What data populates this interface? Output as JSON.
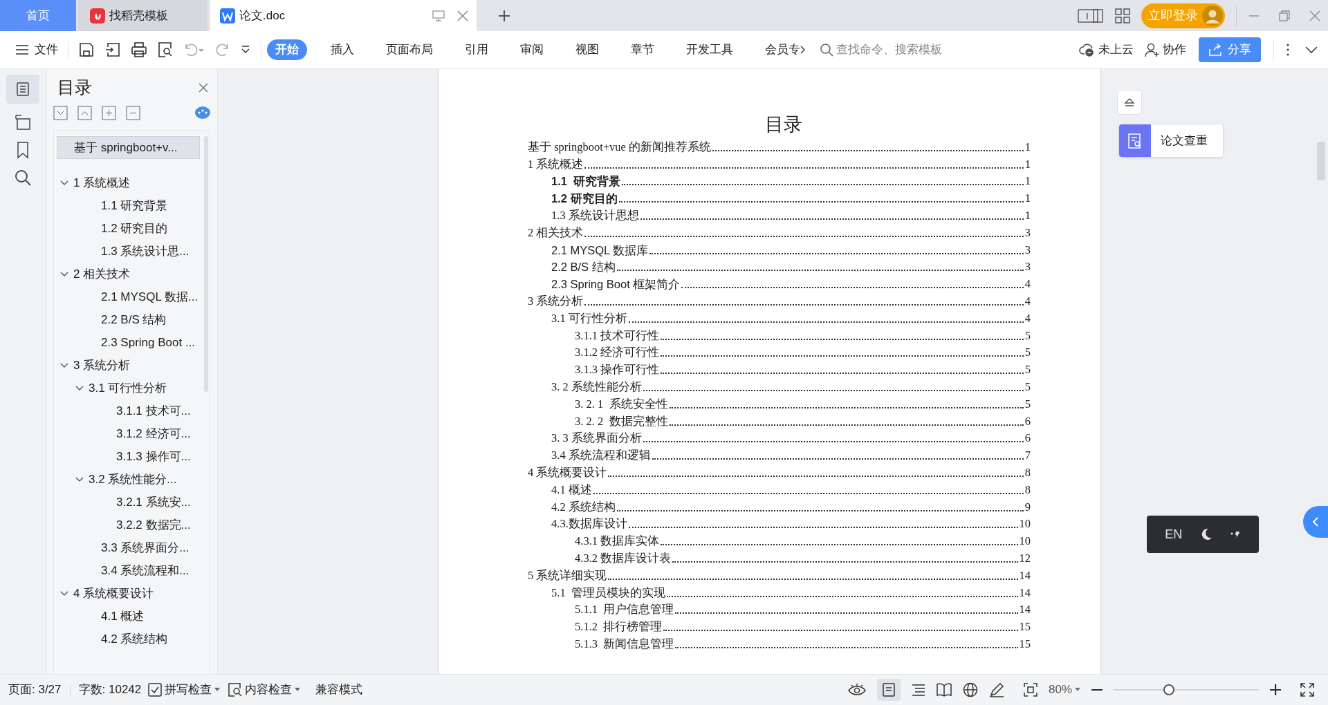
{
  "tabs": [
    {
      "label": "首页",
      "kind": "home",
      "selected": false
    },
    {
      "label": "找稻壳模板",
      "kind": "template",
      "selected": false
    },
    {
      "label": "论文.doc",
      "kind": "document",
      "selected": true
    }
  ],
  "login_button": "立即登录",
  "toolbar": {
    "file_menu": "文件",
    "ribbon_tabs": [
      {
        "label": "开始",
        "selected": true
      },
      {
        "label": "插入",
        "selected": false
      },
      {
        "label": "页面布局",
        "selected": false
      },
      {
        "label": "引用",
        "selected": false
      },
      {
        "label": "审阅",
        "selected": false
      },
      {
        "label": "视图",
        "selected": false
      },
      {
        "label": "章节",
        "selected": false
      },
      {
        "label": "开发工具",
        "selected": false
      },
      {
        "label": "会员专",
        "selected": false
      }
    ],
    "search": {
      "placeholder": "查找命令、搜索模板"
    },
    "cloud_status": "未上云",
    "collaborate": "协作",
    "share": "分享"
  },
  "sidebar": {
    "title": "目录",
    "items": [
      {
        "label": "基于 springboot+v...",
        "selected": true
      },
      {
        "label": "1 系统概述",
        "selected": false,
        "expanded": true,
        "children": [
          {
            "label": "1.1 研究背景",
            "selected": false
          },
          {
            "label": "1.2 研究目的",
            "selected": false
          },
          {
            "label": "1.3 系统设计思...",
            "selected": false
          }
        ]
      },
      {
        "label": "2 相关技术",
        "selected": false,
        "expanded": true,
        "children": [
          {
            "label": "2.1 MYSQL 数据...",
            "selected": false
          },
          {
            "label": "2.2 B/S 结构",
            "selected": false
          },
          {
            "label": "2.3 Spring Boot ...",
            "selected": false
          }
        ]
      },
      {
        "label": "3 系统分析",
        "selected": false,
        "expanded": true,
        "children": [
          {
            "label": "3.1 可行性分析",
            "selected": false,
            "expanded": true,
            "children": [
              {
                "label": "3.1.1 技术可...",
                "selected": false
              },
              {
                "label": "3.1.2 经济可...",
                "selected": false
              },
              {
                "label": "3.1.3 操作可...",
                "selected": false
              }
            ]
          },
          {
            "label": "3.2 系统性能分...",
            "selected": false,
            "expanded": true,
            "children": [
              {
                "label": "3.2.1  系统安...",
                "selected": false
              },
              {
                "label": "3.2.2  数据完...",
                "selected": false
              }
            ]
          },
          {
            "label": "3.3 系统界面分...",
            "selected": false
          },
          {
            "label": "3.4 系统流程和...",
            "selected": false
          }
        ]
      },
      {
        "label": "4 系统概要设计",
        "selected": false,
        "expanded": true,
        "children": [
          {
            "label": "4.1 概述",
            "selected": false
          },
          {
            "label": "4.2 系统结构",
            "selected": false
          }
        ]
      }
    ]
  },
  "document": {
    "title": "目录",
    "entries": [
      {
        "text": "基于 springboot+vue 的新闻推荐系统",
        "page": "1",
        "kind": "serif"
      },
      {
        "text": "1 系统概述",
        "page": "1",
        "kind": "serif",
        "children": [
          {
            "text": "1.1  研究背景",
            "page": "1",
            "kind": "sans-bold"
          },
          {
            "text": "1.2 研究目的",
            "page": "1",
            "kind": "sans-bold"
          },
          {
            "text": "1.3 系统设计思想",
            "page": "1",
            "kind": "serif"
          }
        ]
      },
      {
        "text": "2 相关技术",
        "page": "3",
        "kind": "serif",
        "children": [
          {
            "text": "2.1 MYSQL 数据库",
            "page": "3",
            "kind": "sans"
          },
          {
            "text": "2.2 B/S 结构",
            "page": "3",
            "kind": "sans"
          },
          {
            "text": "2.3 Spring Boot 框架简介",
            "page": "4",
            "kind": "sans"
          }
        ]
      },
      {
        "text": "3 系统分析",
        "page": "4",
        "kind": "serif",
        "children": [
          {
            "text": "3.1 可行性分析",
            "page": "4",
            "kind": "serif",
            "children": [
              {
                "text": "3.1.1 技术可行性",
                "page": "5",
                "kind": "serif"
              },
              {
                "text": "3.1.2 经济可行性",
                "page": "5",
                "kind": "serif"
              },
              {
                "text": "3.1.3 操作可行性",
                "page": "5",
                "kind": "serif"
              }
            ]
          },
          {
            "text": "3. 2 系统性能分析",
            "page": "5",
            "kind": "serif",
            "children": [
              {
                "text": "3. 2. 1  系统安全性",
                "page": "5",
                "kind": "serif"
              },
              {
                "text": "3. 2. 2  数据完整性",
                "page": "6",
                "kind": "serif"
              }
            ]
          },
          {
            "text": "3. 3 系统界面分析",
            "page": "6",
            "kind": "serif"
          },
          {
            "text": "3.4 系统流程和逻辑",
            "page": "7",
            "kind": "serif"
          }
        ]
      },
      {
        "text": "4 系统概要设计",
        "page": "8",
        "kind": "serif",
        "children": [
          {
            "text": "4.1 概述",
            "page": "8",
            "kind": "serif"
          },
          {
            "text": "4.2 系统结构",
            "page": "9",
            "kind": "serif"
          },
          {
            "text": "4.3.数据库设计",
            "page": "10",
            "kind": "serif",
            "children": [
              {
                "text": "4.3.1 数据库实体",
                "page": "10",
                "kind": "serif"
              },
              {
                "text": "4.3.2 数据库设计表",
                "page": "12",
                "kind": "serif"
              }
            ]
          }
        ]
      },
      {
        "text": "5 系统详细实现",
        "page": "14",
        "kind": "serif",
        "children": [
          {
            "text": "5.1  管理员模块的实现",
            "page": "14",
            "kind": "serif",
            "children": [
              {
                "text": "5.1.1  用户信息管理",
                "page": "14",
                "kind": "serif"
              },
              {
                "text": "5.1.2  排行榜管理",
                "page": "15",
                "kind": "serif"
              },
              {
                "text": "5.1.3  新闻信息管理",
                "page": "15",
                "kind": "serif"
              }
            ]
          }
        ]
      }
    ]
  },
  "right_panel": {
    "plagiarism_check": "论文查重"
  },
  "input_widget": {
    "language": "EN"
  },
  "status_bar": {
    "page": "页面: 3/27",
    "word_count": "字数: 10242",
    "spell_check": "拼写检查",
    "content_check": "内容检查",
    "mode": "兼容模式",
    "zoom": "80%",
    "zoom_slider": {
      "level": 0.38
    }
  }
}
